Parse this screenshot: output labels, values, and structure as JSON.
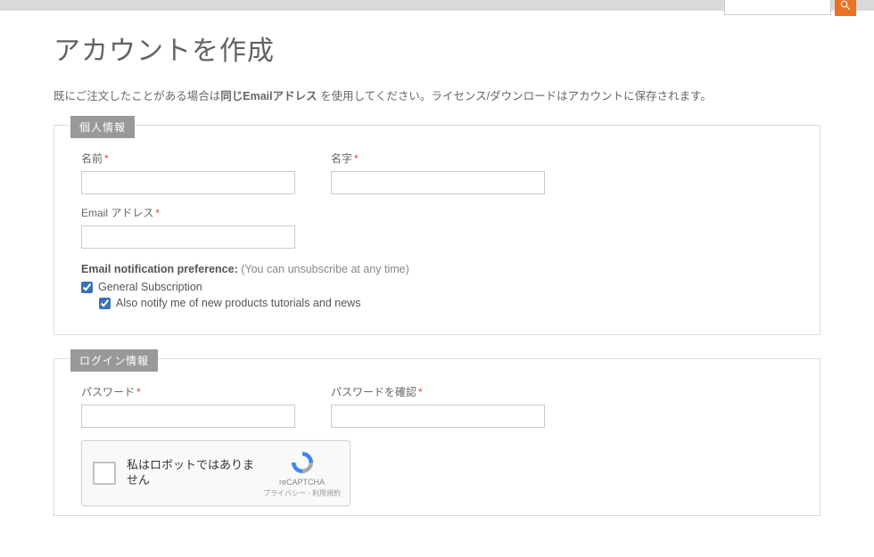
{
  "search": {
    "placeholder": ""
  },
  "page_title": "アカウントを作成",
  "instruction": {
    "pre": "既にご注文したことがある場合は",
    "bold": "同じEmailアドレス",
    "post": " を使用してください。ライセンス/ダウンロードはアカウントに保存されます。"
  },
  "personal": {
    "legend": "個人情報",
    "first_name_label": "名前",
    "last_name_label": "名字",
    "email_label": "Email アドレス",
    "notif_heading_strong": "Email notification preference:",
    "notif_heading_note": "(You can unsubscribe at any time)",
    "general_sub_label": "General Subscription",
    "also_notify_label": "Also notify me of new products tutorials and news"
  },
  "login": {
    "legend": "ログイン情報",
    "password_label": "パスワード",
    "confirm_label": "パスワードを確認",
    "recaptcha_text": "私はロボットではありません",
    "recaptcha_name": "reCAPTCHA",
    "recaptcha_terms": "プライバシー - 利用規約"
  },
  "required_marker": "*"
}
